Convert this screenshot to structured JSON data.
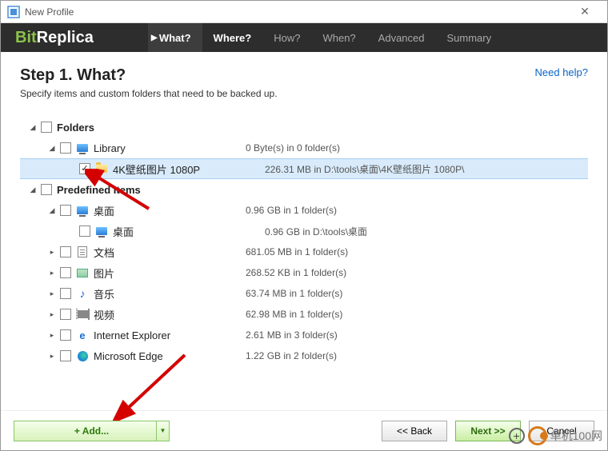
{
  "window": {
    "title": "New Profile"
  },
  "logo": {
    "bit": "Bit",
    "rep": "Replica"
  },
  "nav": {
    "what": "What?",
    "where": "Where?",
    "how": "How?",
    "when": "When?",
    "advanced": "Advanced",
    "summary": "Summary"
  },
  "step": {
    "title": "Step 1. What?",
    "desc": "Specify items and custom folders that need to be backed up."
  },
  "help": "Need help?",
  "tree": {
    "folders_label": "Folders",
    "library": {
      "label": "Library",
      "info": "0 Byte(s) in 0 folder(s)"
    },
    "wp": {
      "label": "4K壁纸图片 1080P",
      "info": "226.31 MB in D:\\tools\\桌面\\4K壁纸图片 1080P\\"
    },
    "predef_label": "Predefined Items",
    "desktop": {
      "label": "桌面",
      "info": "0.96 GB in 1 folder(s)"
    },
    "desktop_sub": {
      "label": "桌面",
      "info": "0.96 GB in D:\\tools\\桌面"
    },
    "docs": {
      "label": "文档",
      "info": "681.05 MB in 1 folder(s)"
    },
    "pics": {
      "label": "图片",
      "info": "268.52 KB in 1 folder(s)"
    },
    "music": {
      "label": "音乐",
      "info": "63.74 MB in 1 folder(s)"
    },
    "video": {
      "label": "视频",
      "info": "62.98 MB in 1 folder(s)"
    },
    "ie": {
      "label": "Internet Explorer",
      "info": "2.61 MB in 3 folder(s)"
    },
    "edge": {
      "label": "Microsoft Edge",
      "info": "1.22 GB in 2 folder(s)"
    }
  },
  "buttons": {
    "add": "+  Add...",
    "back": "<<  Back",
    "next": "Next  >>",
    "cancel": "Cancel"
  },
  "watermark": "单机100网"
}
